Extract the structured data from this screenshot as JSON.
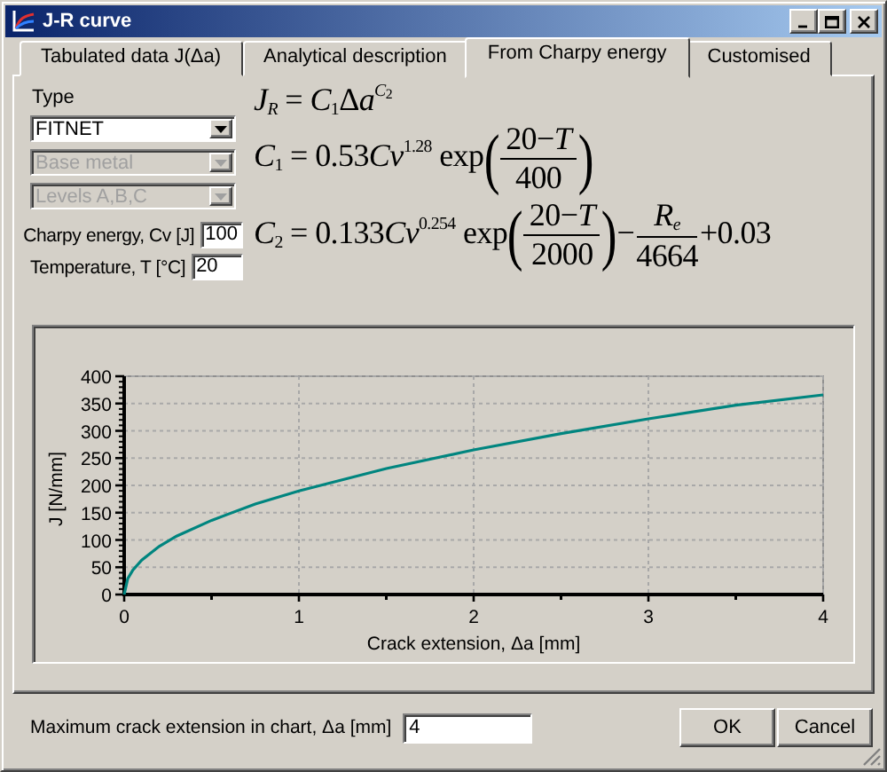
{
  "window": {
    "title": "J-R curve"
  },
  "tabs": [
    {
      "label": "Tabulated data J(Δa)",
      "selected": false
    },
    {
      "label": "Analytical description",
      "selected": false
    },
    {
      "label": "From Charpy energy",
      "selected": true
    },
    {
      "label": "Customised",
      "selected": false
    }
  ],
  "type_label": "Type",
  "selects": [
    {
      "value": "FITNET",
      "disabled": false
    },
    {
      "value": "Base metal",
      "disabled": true
    },
    {
      "value": "Levels A,B,C",
      "disabled": true
    }
  ],
  "fields": [
    {
      "label": "Charpy energy, Cv [J]",
      "value": "100"
    },
    {
      "label": "Temperature, T [°C]",
      "value": "20"
    }
  ],
  "formulas": [
    {
      "parts": [
        {
          "kind": "var",
          "text": "J"
        },
        {
          "kind": "sub",
          "parts": [
            {
              "kind": "var",
              "text": "R"
            }
          ]
        },
        {
          "kind": "text",
          "text": " = "
        },
        {
          "kind": "var",
          "text": "C"
        },
        {
          "kind": "sub",
          "parts": [
            {
              "kind": "text",
              "text": "1"
            }
          ]
        },
        {
          "kind": "text",
          "text": "Δ"
        },
        {
          "kind": "var",
          "text": "a"
        },
        {
          "kind": "sup",
          "parts": [
            {
              "kind": "var",
              "text": "C"
            },
            {
              "kind": "sub",
              "parts": [
                {
                  "kind": "text",
                  "text": "2"
                }
              ]
            }
          ]
        }
      ]
    },
    {
      "parts": [
        {
          "kind": "var",
          "text": "C"
        },
        {
          "kind": "sub",
          "parts": [
            {
              "kind": "text",
              "text": "1"
            }
          ]
        },
        {
          "kind": "text",
          "text": " = 0.53"
        },
        {
          "kind": "var",
          "text": "Cv"
        },
        {
          "kind": "sup",
          "parts": [
            {
              "kind": "text",
              "text": "1.28"
            }
          ]
        },
        {
          "kind": "text",
          "text": " exp"
        },
        {
          "kind": "paren",
          "text": "("
        },
        {
          "kind": "frac",
          "num": [
            {
              "kind": "text",
              "text": "20−"
            },
            {
              "kind": "var",
              "text": "T"
            }
          ],
          "den": [
            {
              "kind": "text",
              "text": "400"
            }
          ]
        },
        {
          "kind": "paren",
          "text": ")"
        }
      ]
    },
    {
      "parts": [
        {
          "kind": "var",
          "text": "C"
        },
        {
          "kind": "sub",
          "parts": [
            {
              "kind": "text",
              "text": "2"
            }
          ]
        },
        {
          "kind": "text",
          "text": " = 0.133"
        },
        {
          "kind": "var",
          "text": "Cv"
        },
        {
          "kind": "sup",
          "parts": [
            {
              "kind": "text",
              "text": "0.254"
            }
          ]
        },
        {
          "kind": "text",
          "text": " exp"
        },
        {
          "kind": "paren",
          "text": "("
        },
        {
          "kind": "frac",
          "num": [
            {
              "kind": "text",
              "text": "20−"
            },
            {
              "kind": "var",
              "text": "T"
            }
          ],
          "den": [
            {
              "kind": "text",
              "text": "2000"
            }
          ]
        },
        {
          "kind": "paren",
          "text": ")"
        },
        {
          "kind": "text",
          "text": "−"
        },
        {
          "kind": "frac",
          "num": [
            {
              "kind": "var",
              "text": "R"
            },
            {
              "kind": "sub",
              "parts": [
                {
                  "kind": "var",
                  "text": "e"
                }
              ]
            }
          ],
          "den": [
            {
              "kind": "text",
              "text": "4664"
            }
          ]
        },
        {
          "kind": "text",
          "text": "+0.03"
        }
      ]
    }
  ],
  "chart": {
    "chart_data": {
      "type": "line",
      "xlabel": "Crack extension, Δa [mm]",
      "ylabel": "J [N/mm]",
      "grid": true,
      "x": [
        0,
        0.02,
        0.05,
        0.1,
        0.2,
        0.3,
        0.5,
        0.75,
        1,
        1.5,
        2,
        2.5,
        3,
        3.5,
        4
      ],
      "series": [
        {
          "color": "#00857f",
          "values": [
            0,
            29,
            45,
            63,
            88,
            107,
            136,
            166,
            190,
            231,
            265,
            295,
            322,
            347,
            366
          ]
        }
      ],
      "xlim": [
        0,
        4
      ],
      "ylim": [
        0,
        400
      ],
      "xticks": [
        0,
        1,
        2,
        3,
        4
      ],
      "yticks": [
        0,
        50,
        100,
        150,
        200,
        250,
        300,
        350,
        400
      ]
    }
  },
  "max_extension": {
    "label": "Maximum crack extension in chart, Δa [mm]",
    "value": "4"
  },
  "buttons": [
    "OK",
    "Cancel"
  ]
}
